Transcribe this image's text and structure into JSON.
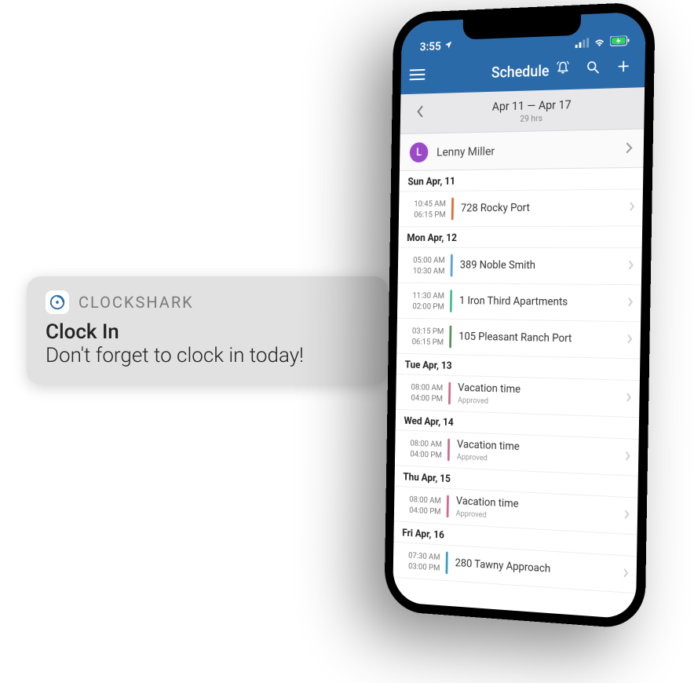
{
  "notification": {
    "app_name": "CLOCKSHARK",
    "title": "Clock In",
    "body": "Don't forget to clock in today!"
  },
  "status": {
    "time": "3:55",
    "location_icon": "location-arrow-icon",
    "signal_icon": "signal-icon",
    "wifi_icon": "wifi-icon",
    "battery_icon": "battery-charging-icon"
  },
  "nav": {
    "title": "Schedule",
    "menu_icon": "hamburger-icon",
    "notifications_icon": "bell-icon",
    "search_icon": "search-icon",
    "add_icon": "plus-icon"
  },
  "range": {
    "label": "Apr 11 — Apr 17",
    "hours": "29 hrs"
  },
  "employee": {
    "initial": "L",
    "name": "Lenny Miller",
    "avatar_color": "#9b4ac7"
  },
  "colors": {
    "header": "#2b6aa8"
  },
  "days": [
    {
      "label": "Sun Apr, 11",
      "shifts": [
        {
          "start": "10:45 AM",
          "end": "06:15 PM",
          "title": "728 Rocky Port",
          "sub": "",
          "color": "#e06a3b"
        }
      ]
    },
    {
      "label": "Mon Apr, 12",
      "shifts": [
        {
          "start": "05:00 AM",
          "end": "10:30 AM",
          "title": "389 Noble Smith",
          "sub": "",
          "color": "#5aa0d6"
        },
        {
          "start": "11:30 AM",
          "end": "02:00 PM",
          "title": "1 Iron Third Apartments",
          "sub": "",
          "color": "#3fbf8f"
        },
        {
          "start": "03:15 PM",
          "end": "06:15 PM",
          "title": "105 Pleasant Ranch Port",
          "sub": "",
          "color": "#5a8f56"
        }
      ]
    },
    {
      "label": "Tue Apr, 13",
      "shifts": [
        {
          "start": "08:00 AM",
          "end": "04:00 PM",
          "title": "Vacation time",
          "sub": "Approved",
          "color": "#d06a8a"
        }
      ]
    },
    {
      "label": "Wed Apr, 14",
      "shifts": [
        {
          "start": "08:00 AM",
          "end": "04:00 PM",
          "title": "Vacation time",
          "sub": "Approved",
          "color": "#d06a8a"
        }
      ]
    },
    {
      "label": "Thu Apr, 15",
      "shifts": [
        {
          "start": "08:00 AM",
          "end": "04:00 PM",
          "title": "Vacation time",
          "sub": "Approved",
          "color": "#d06a8a"
        }
      ]
    },
    {
      "label": "Fri Apr, 16",
      "shifts": [
        {
          "start": "07:30 AM",
          "end": "03:00 PM",
          "title": "280 Tawny Approach",
          "sub": "",
          "color": "#3a9fbf"
        }
      ]
    }
  ]
}
